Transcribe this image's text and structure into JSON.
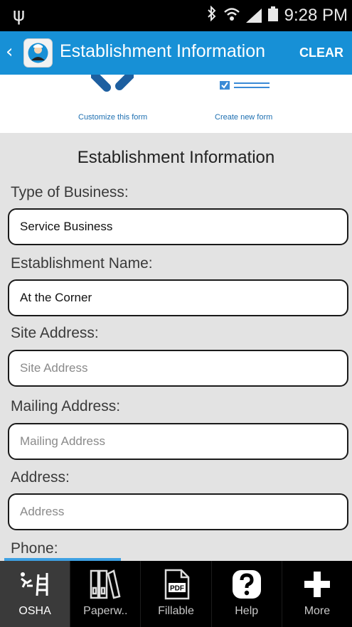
{
  "status_bar": {
    "time": "9:28 PM"
  },
  "action_bar": {
    "back": "‹",
    "title": "Establishment Information",
    "clear_label": "CLEAR"
  },
  "banner": {
    "customize_label": "Customize this form",
    "create_label": "Create new form"
  },
  "form": {
    "heading": "Establishment Information",
    "fields": [
      {
        "label": "Type of Business:",
        "value": "Service Business",
        "placeholder": ""
      },
      {
        "label": "Establishment Name:",
        "value": "At the Corner",
        "placeholder": ""
      },
      {
        "label": "Site Address:",
        "value": "",
        "placeholder": "Site Address"
      },
      {
        "label": "Mailing Address:",
        "value": "",
        "placeholder": "Mailing Address"
      },
      {
        "label": "Address:",
        "value": "",
        "placeholder": "Address"
      },
      {
        "label": "Phone:",
        "value": "",
        "placeholder": ""
      }
    ]
  },
  "bottom_nav": {
    "items": [
      {
        "label": "OSHA",
        "icon": "ladder-fall-icon",
        "active": true
      },
      {
        "label": "Paperw..",
        "icon": "binders-icon",
        "active": false
      },
      {
        "label": "Fillable",
        "icon": "pdf-document-icon",
        "active": false
      },
      {
        "label": "Help",
        "icon": "question-icon",
        "active": false
      },
      {
        "label": "More",
        "icon": "plus-icon",
        "active": false
      }
    ]
  },
  "colors": {
    "accent": "#1790d6",
    "form_background": "#e3e3e3",
    "nav_background": "#000000",
    "nav_active": "#3a3a3a"
  }
}
